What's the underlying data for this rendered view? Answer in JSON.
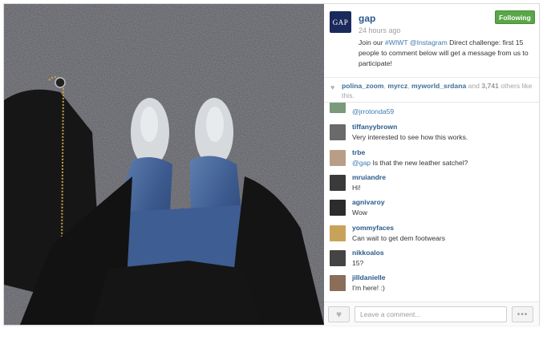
{
  "post": {
    "username": "gap",
    "time_ago": "24 hours ago",
    "follow_label": "Following",
    "logo_text": "GAP",
    "caption_parts": [
      "Join our ",
      "#WIWT",
      " ",
      "@Instagram",
      " Direct challenge: first 15 people to comment below will get a message from us to participate!"
    ]
  },
  "likes": {
    "users": [
      "polina_zoom",
      "myrcz",
      "myworld_srdana"
    ],
    "sep1": ", ",
    "sep2": ", ",
    "and_text": " and ",
    "others_count": "3,741",
    "others_suffix": " others like this."
  },
  "comments": [
    {
      "user": "",
      "text": "@jrrotonda59",
      "is_mention": true,
      "avatar_color": "#7a9a7a"
    },
    {
      "user": "tiffanyybrown",
      "text": "Very interested to see how this works.",
      "avatar_color": "#6a6a6a"
    },
    {
      "user": "trbe",
      "mention": "@gap",
      "text": " Is that the new leather satchel?",
      "avatar_color": "#b89e88"
    },
    {
      "user": "mruiandre",
      "text": "Hi!",
      "avatar_color": "#3a3a3a"
    },
    {
      "user": "agnivaroy",
      "text": "Wow",
      "avatar_color": "#2c2c2c"
    },
    {
      "user": "yommyfaces",
      "text": "Can wait to get dem footwears",
      "avatar_color": "#c9a25a"
    },
    {
      "user": "nikkoalos",
      "text": "15?",
      "avatar_color": "#444444"
    },
    {
      "user": "jilldanielle",
      "text": "I'm here! :)",
      "avatar_color": "#8a6e5a"
    }
  ],
  "footer": {
    "comment_placeholder": "Leave a comment...",
    "more_label": "•••"
  },
  "icons": {
    "like": "heart-icon",
    "likes_summary": "heart-icon",
    "more": "ellipsis-icon"
  },
  "colors": {
    "link": "#2a5a8a",
    "follow_green": "#5aa648",
    "gap_navy": "#1a2a5c"
  }
}
